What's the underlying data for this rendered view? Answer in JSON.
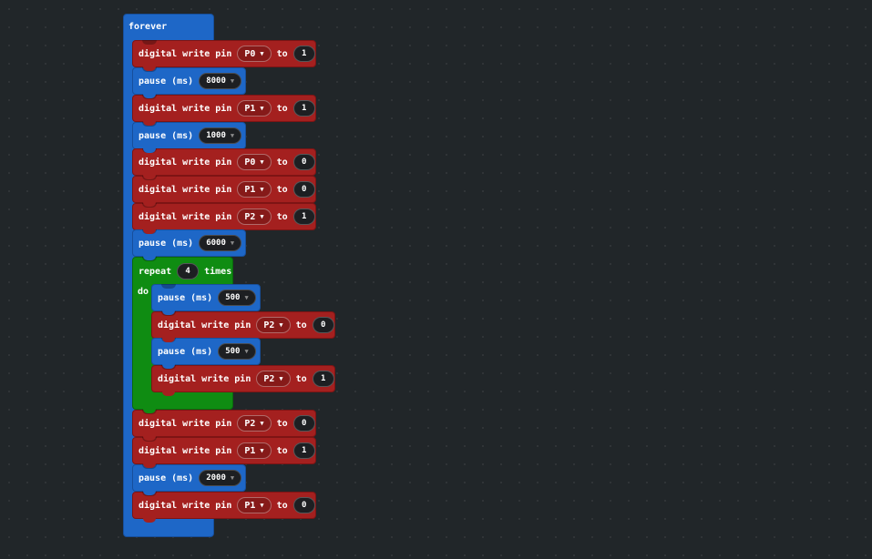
{
  "forever_label": "forever",
  "do_label": "do",
  "caret": "▼",
  "texts": {
    "digital_write_pin": "digital write pin",
    "to": "to",
    "pause_ms": "pause (ms)",
    "repeat": "repeat",
    "times": "times"
  },
  "colors": {
    "workspace": "#212629",
    "pins_block": "#a4201f",
    "basic_block": "#1e67c7",
    "loops_block": "#0f8c12"
  },
  "blocks": [
    {
      "type": "digital_write",
      "pin": "P0",
      "value": "1"
    },
    {
      "type": "pause",
      "ms": "8000"
    },
    {
      "type": "digital_write",
      "pin": "P1",
      "value": "1"
    },
    {
      "type": "pause",
      "ms": "1000"
    },
    {
      "type": "digital_write",
      "pin": "P0",
      "value": "0"
    },
    {
      "type": "digital_write",
      "pin": "P1",
      "value": "0"
    },
    {
      "type": "digital_write",
      "pin": "P2",
      "value": "1"
    },
    {
      "type": "pause",
      "ms": "6000"
    },
    {
      "type": "repeat",
      "count": "4",
      "body": [
        {
          "type": "pause",
          "ms": "500"
        },
        {
          "type": "digital_write",
          "pin": "P2",
          "value": "0"
        },
        {
          "type": "pause",
          "ms": "500"
        },
        {
          "type": "digital_write",
          "pin": "P2",
          "value": "1"
        }
      ]
    },
    {
      "type": "digital_write",
      "pin": "P2",
      "value": "0"
    },
    {
      "type": "digital_write",
      "pin": "P1",
      "value": "1"
    },
    {
      "type": "pause",
      "ms": "2000"
    },
    {
      "type": "digital_write",
      "pin": "P1",
      "value": "0"
    }
  ]
}
